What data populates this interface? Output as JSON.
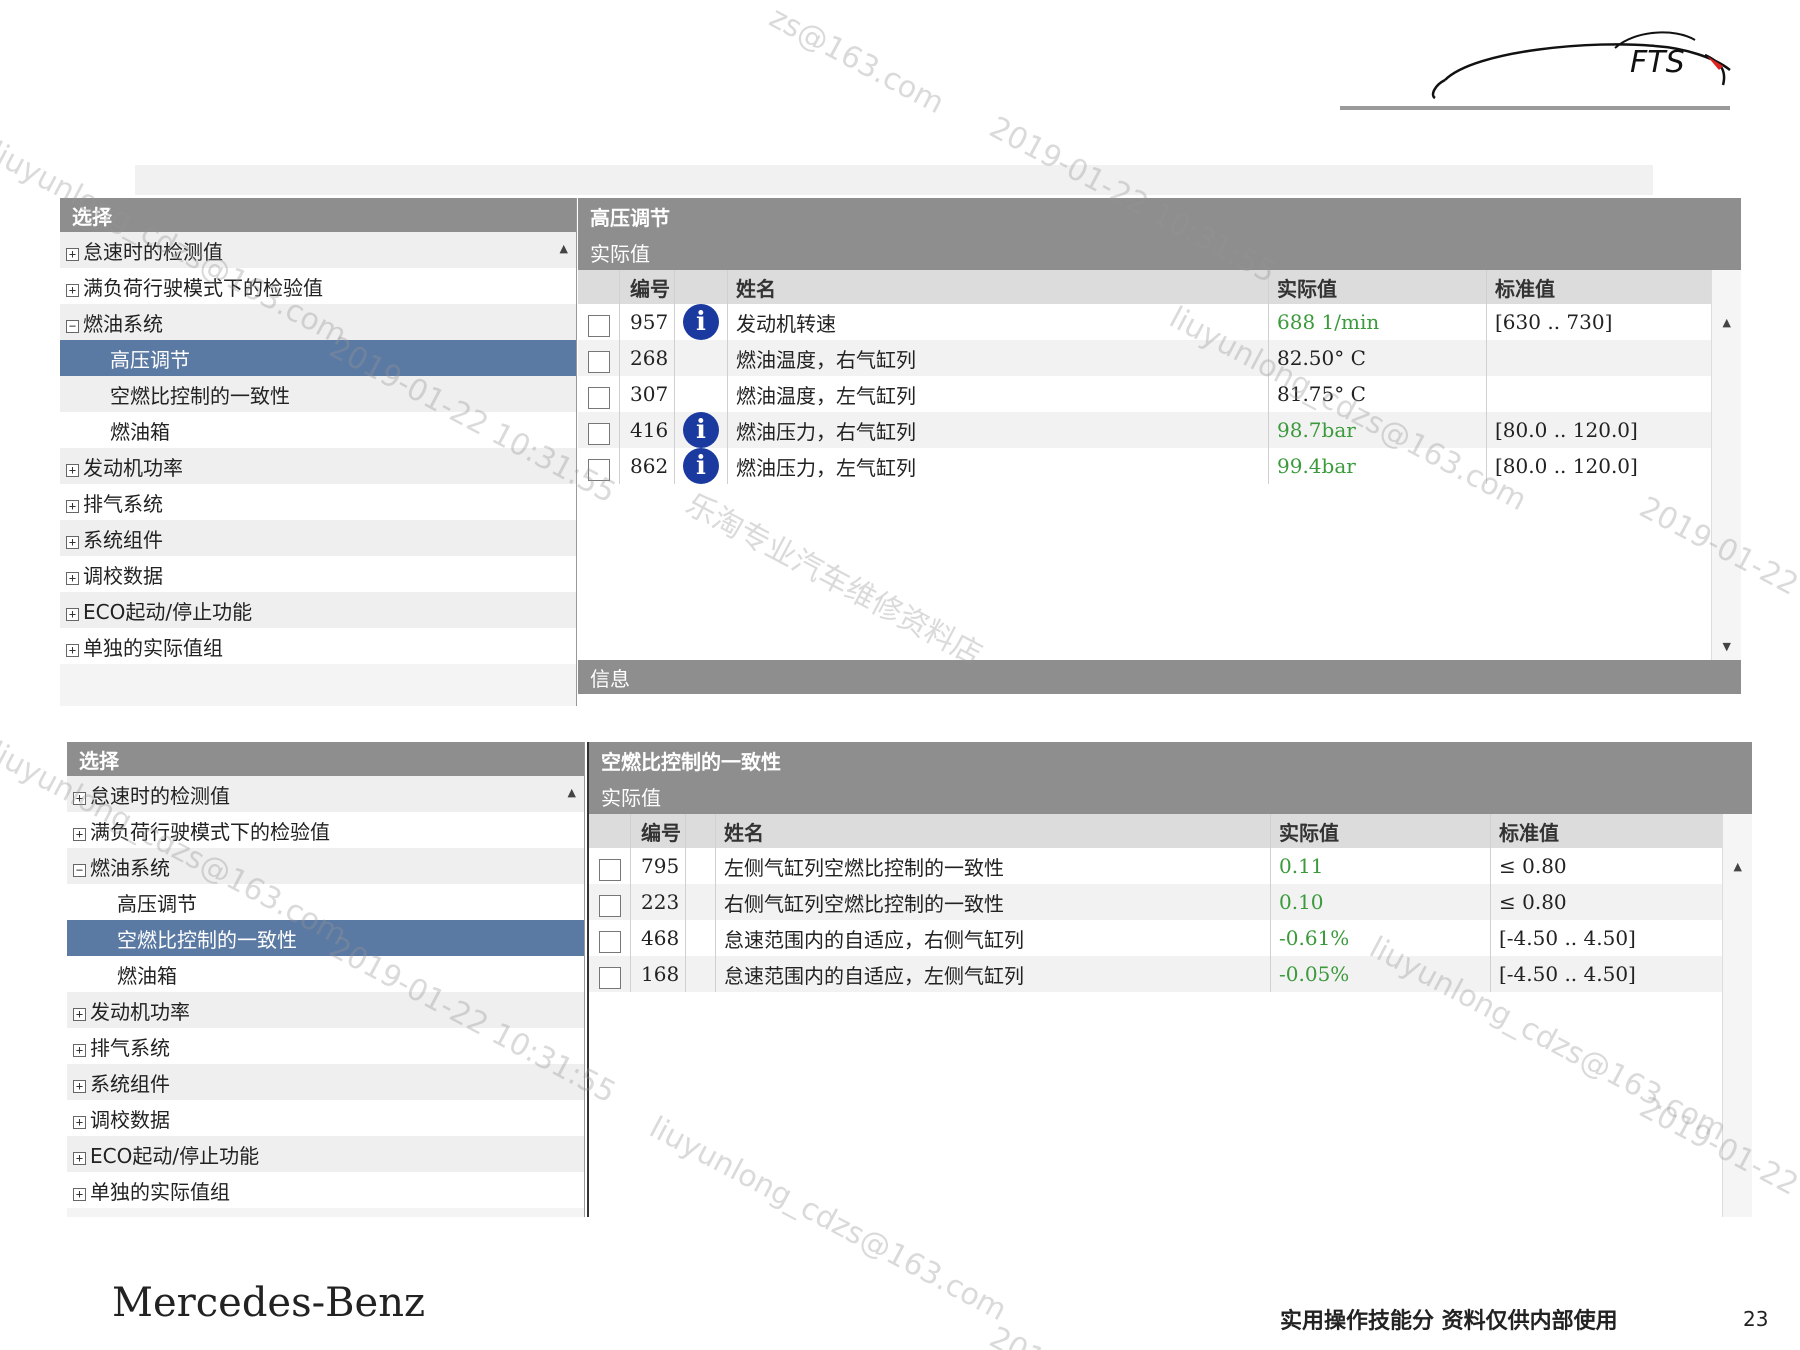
{
  "logo_text": "FTS",
  "colors": {
    "header_gray": "#8e8e8e",
    "selected_blue": "#5b7aa3",
    "value_green": "#3b9a3b",
    "info_blue": "#1a3aa0"
  },
  "top": {
    "tree_title": "选择",
    "tree_items": [
      {
        "label": "怠速时的检测值",
        "expander": "+",
        "level": 0
      },
      {
        "label": "满负荷行驶模式下的检验值",
        "expander": "+",
        "level": 0
      },
      {
        "label": "燃油系统",
        "expander": "−",
        "level": 0
      },
      {
        "label": "高压调节",
        "expander": "",
        "level": 1,
        "selected": true
      },
      {
        "label": "空燃比控制的一致性",
        "expander": "",
        "level": 1
      },
      {
        "label": "燃油箱",
        "expander": "",
        "level": 1
      },
      {
        "label": "发动机功率",
        "expander": "+",
        "level": 0
      },
      {
        "label": "排气系统",
        "expander": "+",
        "level": 0
      },
      {
        "label": "系统组件",
        "expander": "+",
        "level": 0
      },
      {
        "label": "调校数据",
        "expander": "+",
        "level": 0
      },
      {
        "label": "ECO起动/停止功能",
        "expander": "+",
        "level": 0
      },
      {
        "label": "单独的实际值组",
        "expander": "+",
        "level": 0
      }
    ],
    "detail_title": "高压调节",
    "detail_subtitle": "实际值",
    "columns": {
      "code": "编号",
      "name": "姓名",
      "actual": "实际值",
      "standard": "标准值"
    },
    "rows": [
      {
        "code": "957",
        "info": true,
        "name": "发动机转速",
        "actual": "688 1/min",
        "actual_green": true,
        "standard": "[630 .. 730]"
      },
      {
        "code": "268",
        "info": false,
        "name": "燃油温度，右气缸列",
        "actual": "82.50° C",
        "actual_green": false,
        "standard": ""
      },
      {
        "code": "307",
        "info": false,
        "name": "燃油温度，左气缸列",
        "actual": "81.75° C",
        "actual_green": false,
        "standard": ""
      },
      {
        "code": "416",
        "info": true,
        "name": "燃油压力，右气缸列",
        "actual": "98.7bar",
        "actual_green": true,
        "standard": "[80.0 .. 120.0]"
      },
      {
        "code": "862",
        "info": true,
        "name": "燃油压力，左气缸列",
        "actual": "99.4bar",
        "actual_green": true,
        "standard": "[80.0 .. 120.0]"
      }
    ],
    "info_bar": "信息"
  },
  "bottom": {
    "tree_title": "选择",
    "tree_items": [
      {
        "label": "怠速时的检测值",
        "expander": "+",
        "level": 0
      },
      {
        "label": "满负荷行驶模式下的检验值",
        "expander": "+",
        "level": 0
      },
      {
        "label": "燃油系统",
        "expander": "−",
        "level": 0
      },
      {
        "label": "高压调节",
        "expander": "",
        "level": 1
      },
      {
        "label": "空燃比控制的一致性",
        "expander": "",
        "level": 1,
        "selected": true
      },
      {
        "label": "燃油箱",
        "expander": "",
        "level": 1
      },
      {
        "label": "发动机功率",
        "expander": "+",
        "level": 0
      },
      {
        "label": "排气系统",
        "expander": "+",
        "level": 0
      },
      {
        "label": "系统组件",
        "expander": "+",
        "level": 0
      },
      {
        "label": "调校数据",
        "expander": "+",
        "level": 0
      },
      {
        "label": "ECO起动/停止功能",
        "expander": "+",
        "level": 0
      },
      {
        "label": "单独的实际值组",
        "expander": "+",
        "level": 0
      }
    ],
    "detail_title": "空燃比控制的一致性",
    "detail_subtitle": "实际值",
    "columns": {
      "code": "编号",
      "name": "姓名",
      "actual": "实际值",
      "standard": "标准值"
    },
    "rows": [
      {
        "code": "795",
        "name": "左侧气缸列空燃比控制的一致性",
        "actual": "0.11",
        "standard": "≤ 0.80"
      },
      {
        "code": "223",
        "name": "右侧气缸列空燃比控制的一致性",
        "actual": "0.10",
        "standard": "≤ 0.80"
      },
      {
        "code": "468",
        "name": "怠速范围内的自适应，右侧气缸列",
        "actual": "-0.61%",
        "standard": "[-4.50 .. 4.50]"
      },
      {
        "code": "168",
        "name": "怠速范围内的自适应，左侧气缸列",
        "actual": "-0.05%",
        "standard": "[-4.50 .. 4.50]"
      }
    ]
  },
  "watermarks": [
    "zs@163.com",
    "2019-01-22 10:31:55",
    "liuyunlong_cdzs@163.com",
    "2019-01-22 10:31:55",
    "liuyunlong_cdzs@163.com",
    "乐淘专业汽车维修资料店",
    "2019-01-22",
    "liuyunlong_cdzs@163.com",
    "2019-01-22 10:31:55",
    "liuyunlong_cdzs@163.com",
    "2019-01-22",
    "liuyunlong_cdzs@163.com",
    "2019-"
  ],
  "footer": {
    "brand": "Mercedes-Benz",
    "note": "实用操作技能分 资料仅供内部使用",
    "page": "23"
  }
}
